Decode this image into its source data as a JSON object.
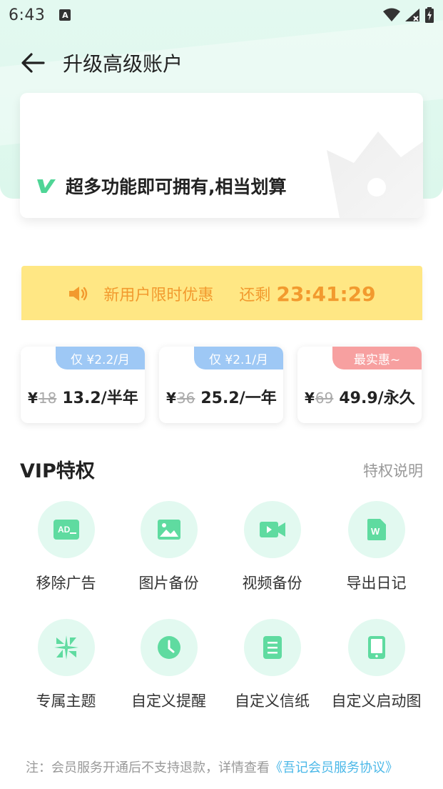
{
  "status_bar": {
    "time": "6:43",
    "notification_icon": "A"
  },
  "header": {
    "title": "升级高级账户"
  },
  "banner": {
    "text": "超多功能即可拥有,相当划算"
  },
  "promo": {
    "label": "新用户限时优惠",
    "remaining_label": "还剩",
    "countdown": "23:41:29"
  },
  "plans": [
    {
      "badge": "仅 ¥2.2/月",
      "yen": "¥",
      "old_price": "18",
      "new_price": "13.2/半年",
      "badge_color": "#9ec8f5"
    },
    {
      "badge": "仅 ¥2.1/月",
      "yen": "¥",
      "old_price": "36",
      "new_price": "25.2/一年",
      "badge_color": "#9ec8f5"
    },
    {
      "badge": "最实惠~",
      "yen": "¥",
      "old_price": "69",
      "new_price": "49.9/永久",
      "badge_color": "#f7a0a0"
    }
  ],
  "vip": {
    "title": "VIP特权",
    "link": "特权说明",
    "items": [
      {
        "label": "移除广告",
        "icon": "ad-icon"
      },
      {
        "label": "图片备份",
        "icon": "image-icon"
      },
      {
        "label": "视频备份",
        "icon": "video-icon"
      },
      {
        "label": "导出日记",
        "icon": "word-document-icon"
      },
      {
        "label": "专属主题",
        "icon": "theme-icon"
      },
      {
        "label": "自定义提醒",
        "icon": "clock-icon"
      },
      {
        "label": "自定义信纸",
        "icon": "notepaper-icon"
      },
      {
        "label": "自定义启动图",
        "icon": "phone-icon"
      }
    ]
  },
  "footer": {
    "note": "注：会员服务开通后不支持退款，详情查看",
    "link": "《吾记会员服务协议》"
  },
  "colors": {
    "accent": "#5fdba0",
    "promo_bg": "#ffe784",
    "promo_text": "#f29a2e",
    "icon_bg": "#e2f9f0"
  }
}
